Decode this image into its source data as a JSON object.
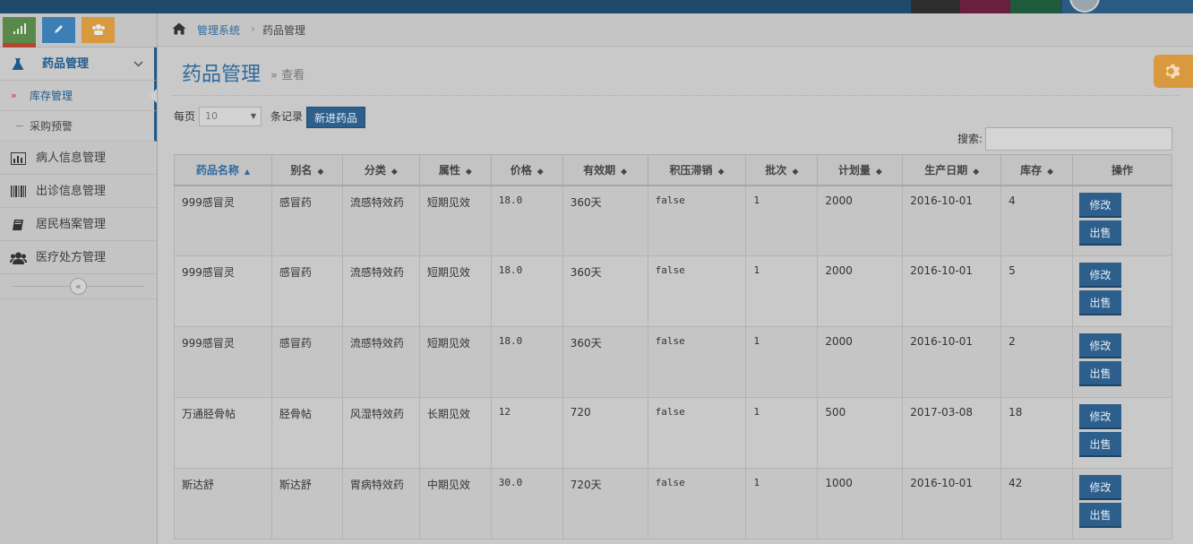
{
  "navbar": {
    "title": "",
    "user_name": "",
    "colors": [
      "#2d2d2d",
      "#6b1f3f",
      "#1f5a3a",
      "#1f4a6e"
    ]
  },
  "shortcuts": [
    {
      "icon": "signal-icon",
      "color": "#5a8a4a"
    },
    {
      "icon": "pencil-icon",
      "color": "#3b7fb6"
    },
    {
      "icon": "users-icon",
      "color": "#d9993f"
    },
    {
      "icon": "cogs-icon",
      "color": "#b8452f"
    }
  ],
  "sidebar": {
    "open_item": "药品管理",
    "sub_items": [
      "库存管理",
      "采购预警"
    ],
    "items": [
      "病人信息管理",
      "出诊信息管理",
      "居民档案管理",
      "医疗处方管理"
    ],
    "collapse_label": "«"
  },
  "breadcrumb": {
    "home": "管理系统",
    "sep": "›",
    "current": "药品管理"
  },
  "page": {
    "title": "药品管理",
    "subtitle": "» 查看"
  },
  "controls": {
    "per_page_label": "每页",
    "per_page_value": "10",
    "records_label": "条记录",
    "new_button": "新进药品",
    "search_label": "搜索:"
  },
  "table": {
    "headers": [
      "药品名称",
      "别名",
      "分类",
      "属性",
      "价格",
      "有效期",
      "积压滞销",
      "批次",
      "计划量",
      "生产日期",
      "库存",
      "操作"
    ],
    "rows": [
      [
        "999感冒灵",
        "感冒药",
        "流感特效药",
        "短期见效",
        "18.0",
        "360天",
        "false",
        "1",
        "2000",
        "2016-10-01",
        "4"
      ],
      [
        "999感冒灵",
        "感冒药",
        "流感特效药",
        "短期见效",
        "18.0",
        "360天",
        "false",
        "1",
        "2000",
        "2016-10-01",
        "5"
      ],
      [
        "999感冒灵",
        "感冒药",
        "流感特效药",
        "短期见效",
        "18.0",
        "360天",
        "false",
        "1",
        "2000",
        "2016-10-01",
        "2"
      ],
      [
        "万通胫骨帖",
        "胫骨帖",
        "风湿特效药",
        "长期见效",
        "12",
        "720",
        "false",
        "1",
        "500",
        "2017-03-08",
        "18"
      ],
      [
        "斯达舒",
        "斯达舒",
        "胃病特效药",
        "中期见效",
        "30.0",
        "720天",
        "false",
        "1",
        "1000",
        "2016-10-01",
        "42"
      ]
    ],
    "edit_label": "修改",
    "sell_label": "出售"
  }
}
